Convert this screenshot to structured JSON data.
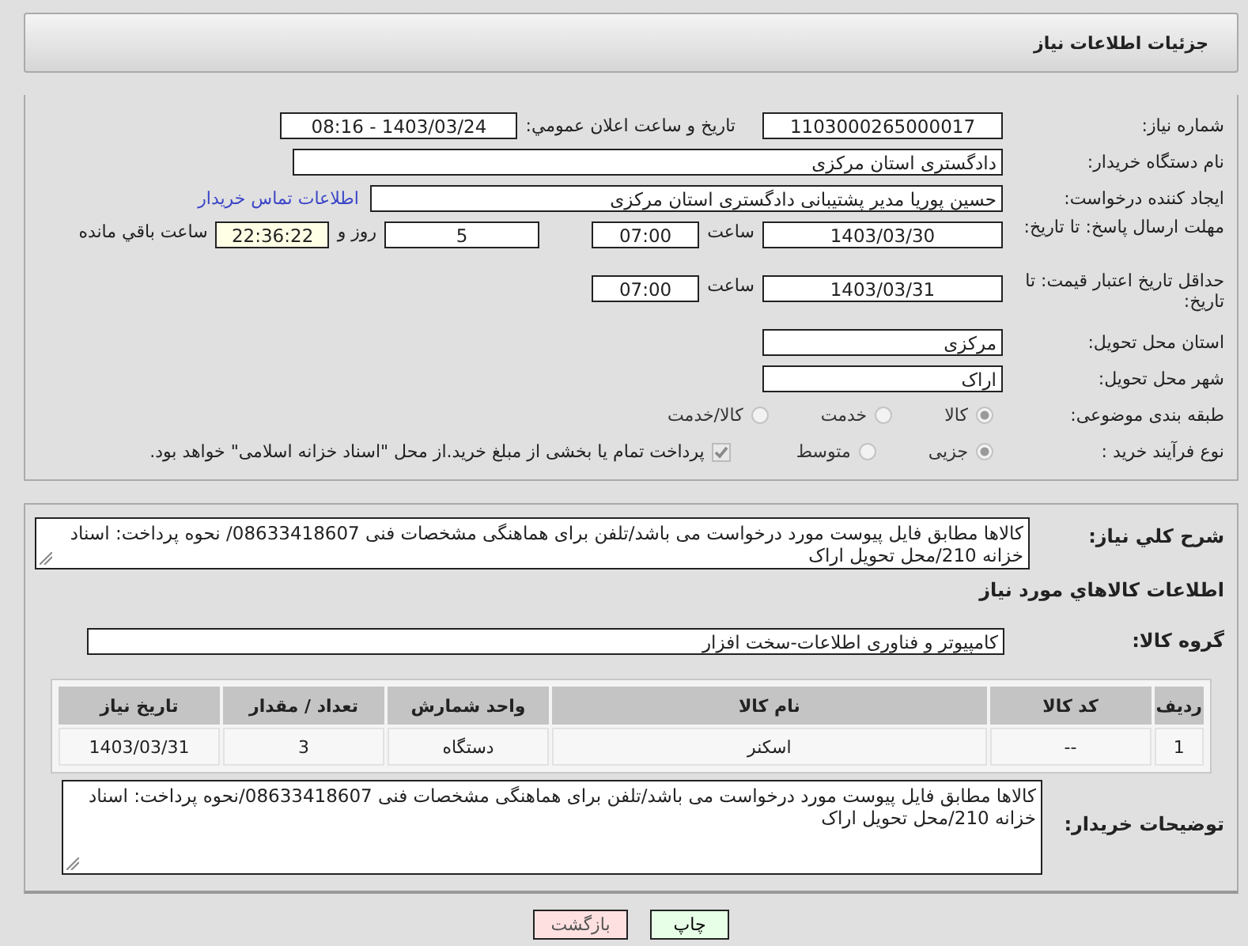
{
  "header": {
    "title": "جزئیات اطلاعات نیاز"
  },
  "need_number": {
    "label": "شماره نیاز:",
    "value": "1103000265000017"
  },
  "announce": {
    "label": "تاریخ و ساعت اعلان عمومي:",
    "value": "1403/03/24 - 08:16"
  },
  "buyer_org": {
    "label": "نام دستگاه خریدار:",
    "value": "دادگستری استان مرکزی"
  },
  "requester": {
    "label": "ایجاد کننده درخواست:",
    "value": "حسین پوریا مدیر پشتیبانی دادگستری استان مرکزی",
    "link": "اطلاعات تماس خریدار"
  },
  "reply_deadline": {
    "label": "مهلت ارسال پاسخ: تا تاریخ:",
    "date": "1403/03/30",
    "time_label": "ساعت",
    "time": "07:00",
    "days": "5",
    "days_label": "روز و",
    "remaining": "22:36:22",
    "remaining_label": "ساعت باقي مانده"
  },
  "price_validity": {
    "label": "حداقل تاریخ اعتبار قیمت: تا تاریخ:",
    "date": "1403/03/31",
    "time_label": "ساعت",
    "time": "07:00"
  },
  "province": {
    "label": "استان محل تحویل:",
    "value": "مرکزی"
  },
  "city": {
    "label": "شهر محل تحویل:",
    "value": "اراک"
  },
  "category": {
    "label": "طبقه بندی موضوعی:",
    "options": [
      {
        "label": "کالا",
        "selected": true
      },
      {
        "label": "خدمت",
        "selected": false
      },
      {
        "label": "کالا/خدمت",
        "selected": false
      }
    ]
  },
  "process": {
    "label": "نوع فرآیند خرید :",
    "options": [
      {
        "label": "جزیی",
        "selected": true
      },
      {
        "label": "متوسط",
        "selected": false
      }
    ],
    "treasury": {
      "checked": true,
      "label": "پرداخت تمام یا بخشی از مبلغ خرید.از محل \"اسناد خزانه اسلامی\" خواهد بود."
    }
  },
  "summary": {
    "label": "شرح کلي نیاز:",
    "value": "کالاها مطابق فایل پیوست مورد درخواست  می باشد/تلفن برای  هماهنگی مشخصات  فنی 08633418607/ نحوه پرداخت: اسناد خزانه 210/محل تحویل اراک"
  },
  "goods_section": {
    "title": "اطلاعات کالاهاي مورد نیاز"
  },
  "goods_group": {
    "label": "گروه کالا:",
    "value": "کامپیوتر و فناوری اطلاعات-سخت افزار"
  },
  "table": {
    "columns": [
      "ردیف",
      "کد کالا",
      "نام کالا",
      "واحد شمارش",
      "تعداد / مقدار",
      "تاریخ نیاز"
    ],
    "rows": [
      [
        "1",
        "--",
        "اسکنر",
        "دستگاه",
        "3",
        "1403/03/31"
      ]
    ]
  },
  "buyer_notes": {
    "label": "توضیحات خریدار:",
    "value": "کالاها مطابق فایل پیوست مورد درخواست  می باشد/تلفن برای  هماهنگی مشخصات  فنی 08633418607/نحوه پرداخت: اسناد خزانه 210/محل تحویل اراک"
  },
  "buttons": [
    {
      "label": "چاپ",
      "kind": "print"
    },
    {
      "label": "بازگشت",
      "kind": "back"
    }
  ]
}
